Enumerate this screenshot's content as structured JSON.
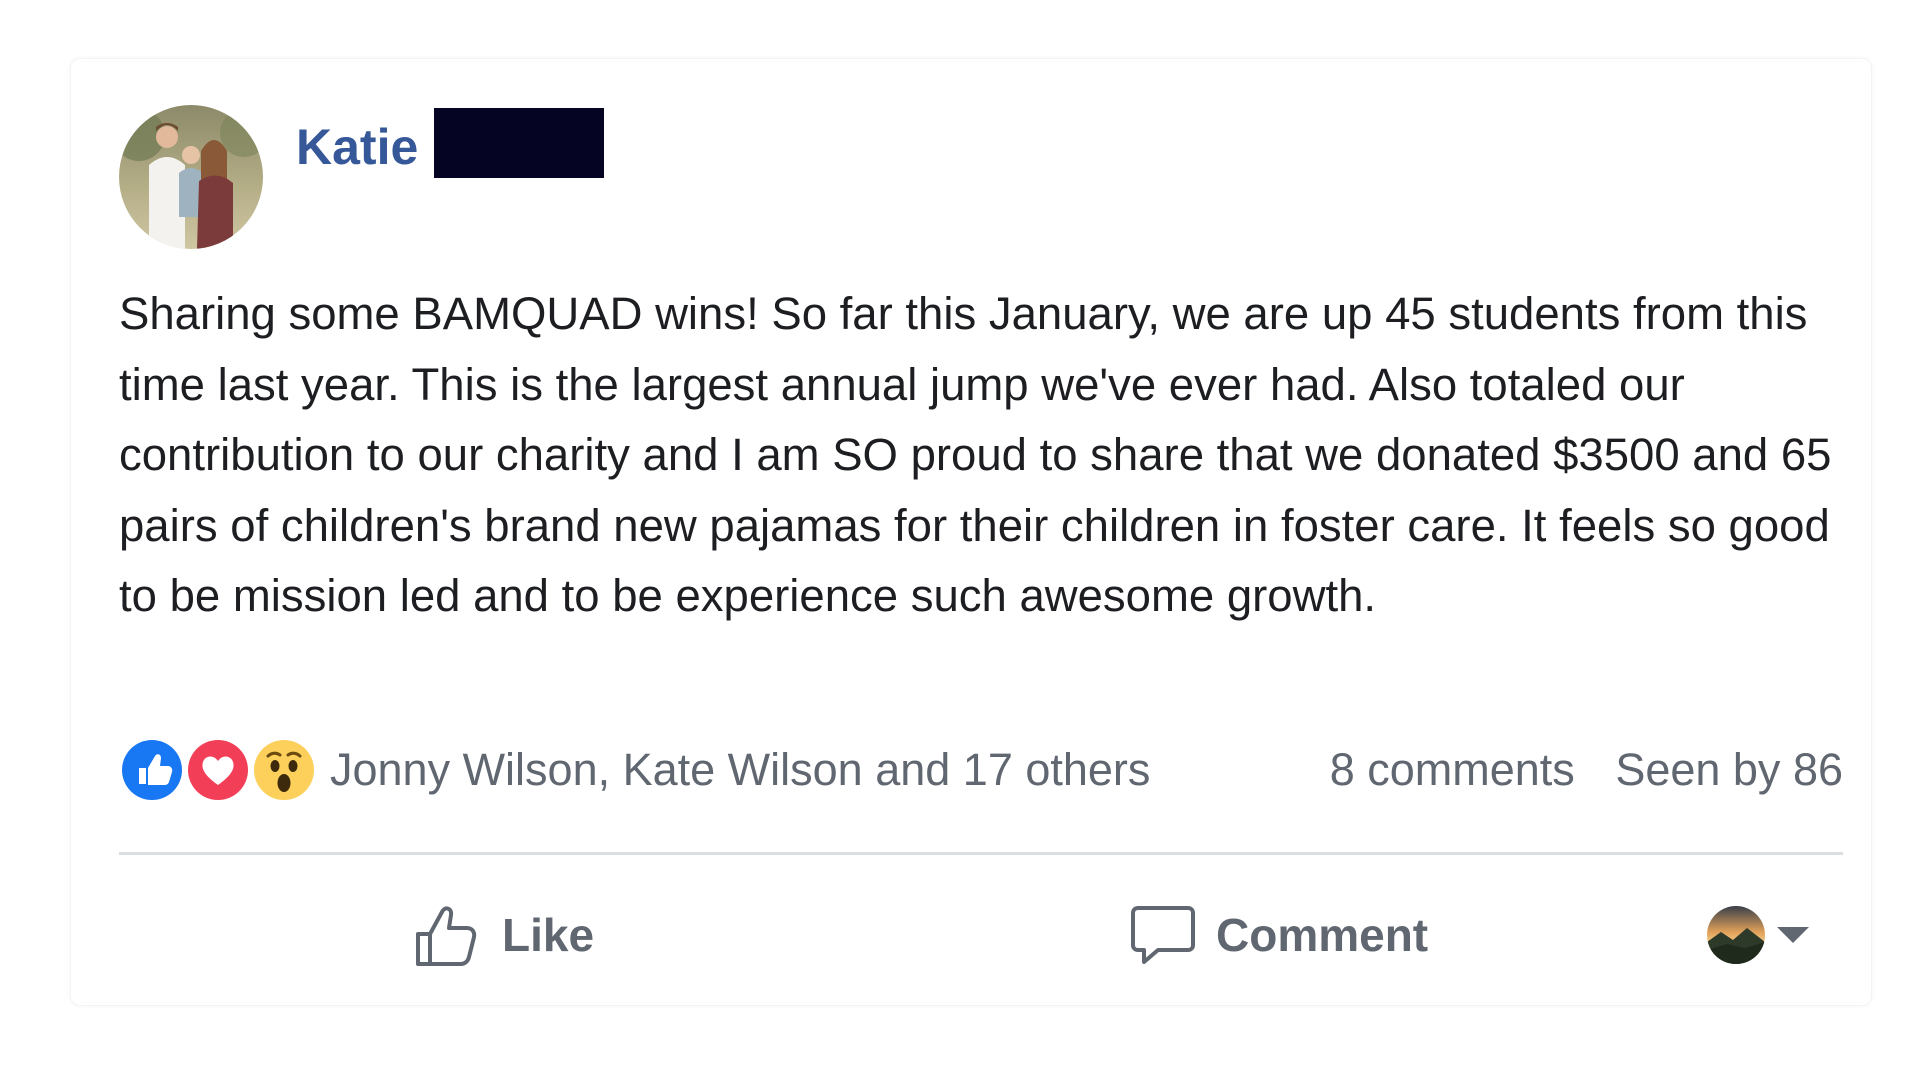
{
  "post": {
    "author": {
      "name": "Katie",
      "name_color": "#365899"
    },
    "text": "Sharing some BAMQUAD wins! So far this January, we are up 45 students from this time last year. This is the largest annual jump we've ever had. Also totaled our contribution to our charity and I am SO proud to share that we donated $3500 and 65 pairs of children's brand new pajamas for their children in foster care. It feels so good to be mission led and to be experience such awesome growth.",
    "reactions": {
      "icons": [
        "like-icon",
        "love-icon",
        "wow-icon"
      ],
      "summary": "Jonny Wilson, Kate Wilson and 17 others"
    },
    "stats": {
      "comments": "8 comments",
      "seen": "Seen by 86"
    },
    "actions": {
      "like_label": "Like",
      "comment_label": "Comment"
    },
    "colors": {
      "like_blue": "#1877f2",
      "love_red": "#f33e58",
      "wow_yellow": "#fcd05a",
      "secondary_text": "#606770",
      "body_text": "#1c1e21"
    }
  }
}
